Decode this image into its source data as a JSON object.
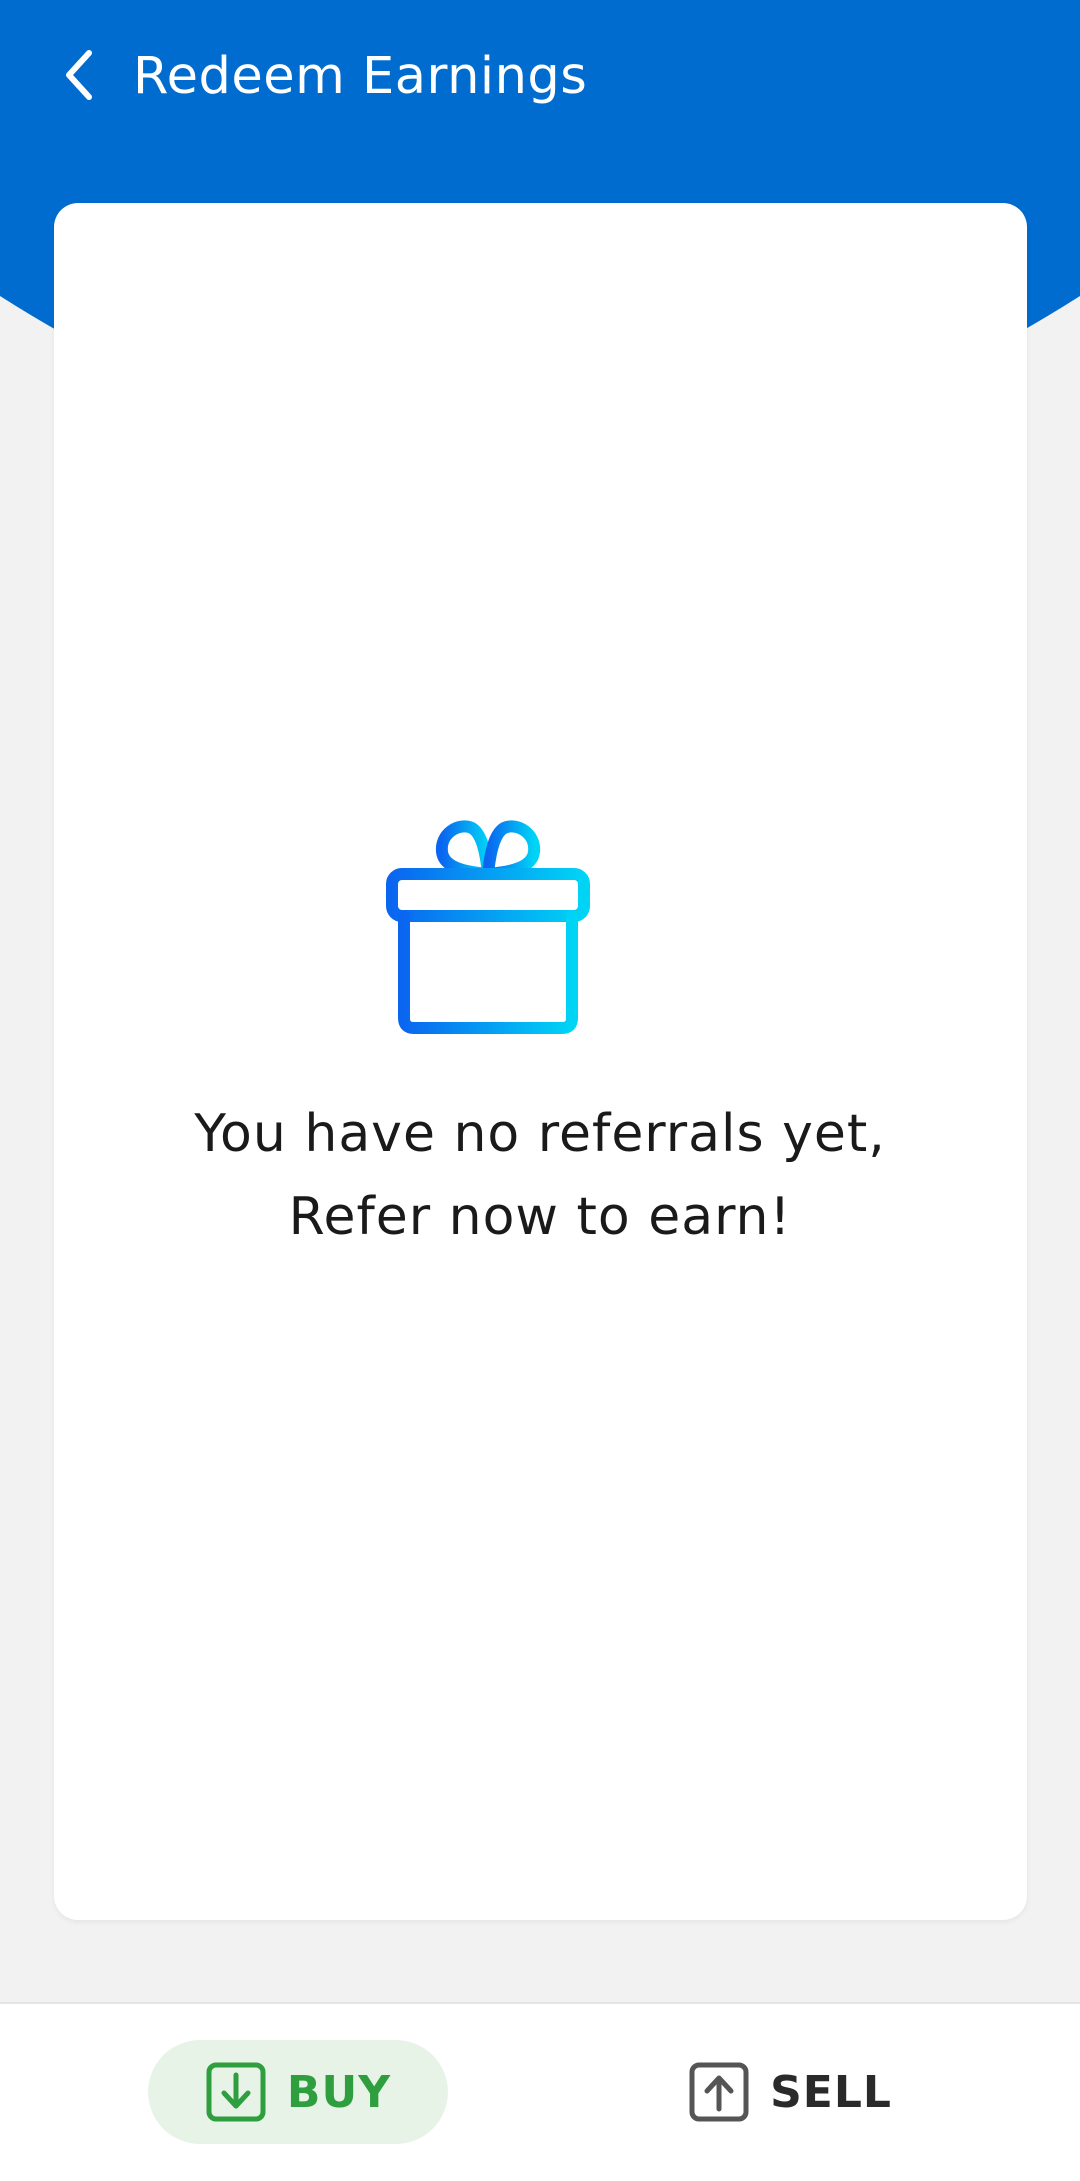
{
  "header": {
    "title": "Redeem Earnings",
    "back_icon": "chevron-left-icon",
    "background_color": "#006ccf"
  },
  "empty_state": {
    "icon": "gift-icon",
    "line1": "You have no referrals yet,",
    "line2": "Refer now to earn!",
    "icon_gradient": [
      "#0a66f0",
      "#00d4f5"
    ]
  },
  "bottom_bar": {
    "buy": {
      "label": "BUY",
      "icon": "arrow-down-box-icon",
      "color": "#2e9e3e",
      "active": true
    },
    "sell": {
      "label": "SELL",
      "icon": "arrow-up-box-icon",
      "color": "#2a2a2a",
      "active": false
    }
  }
}
